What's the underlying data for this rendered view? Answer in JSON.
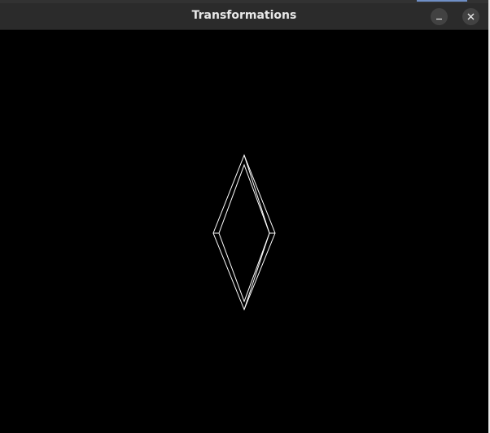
{
  "window": {
    "title": "Transformations"
  },
  "controls": {
    "minimize_icon": "minimize-icon",
    "close_icon": "close-icon"
  },
  "colors": {
    "titlebar": "#2b2b2b",
    "canvas_background": "#000000",
    "stroke": "#ffffff",
    "button": "#424242"
  }
}
